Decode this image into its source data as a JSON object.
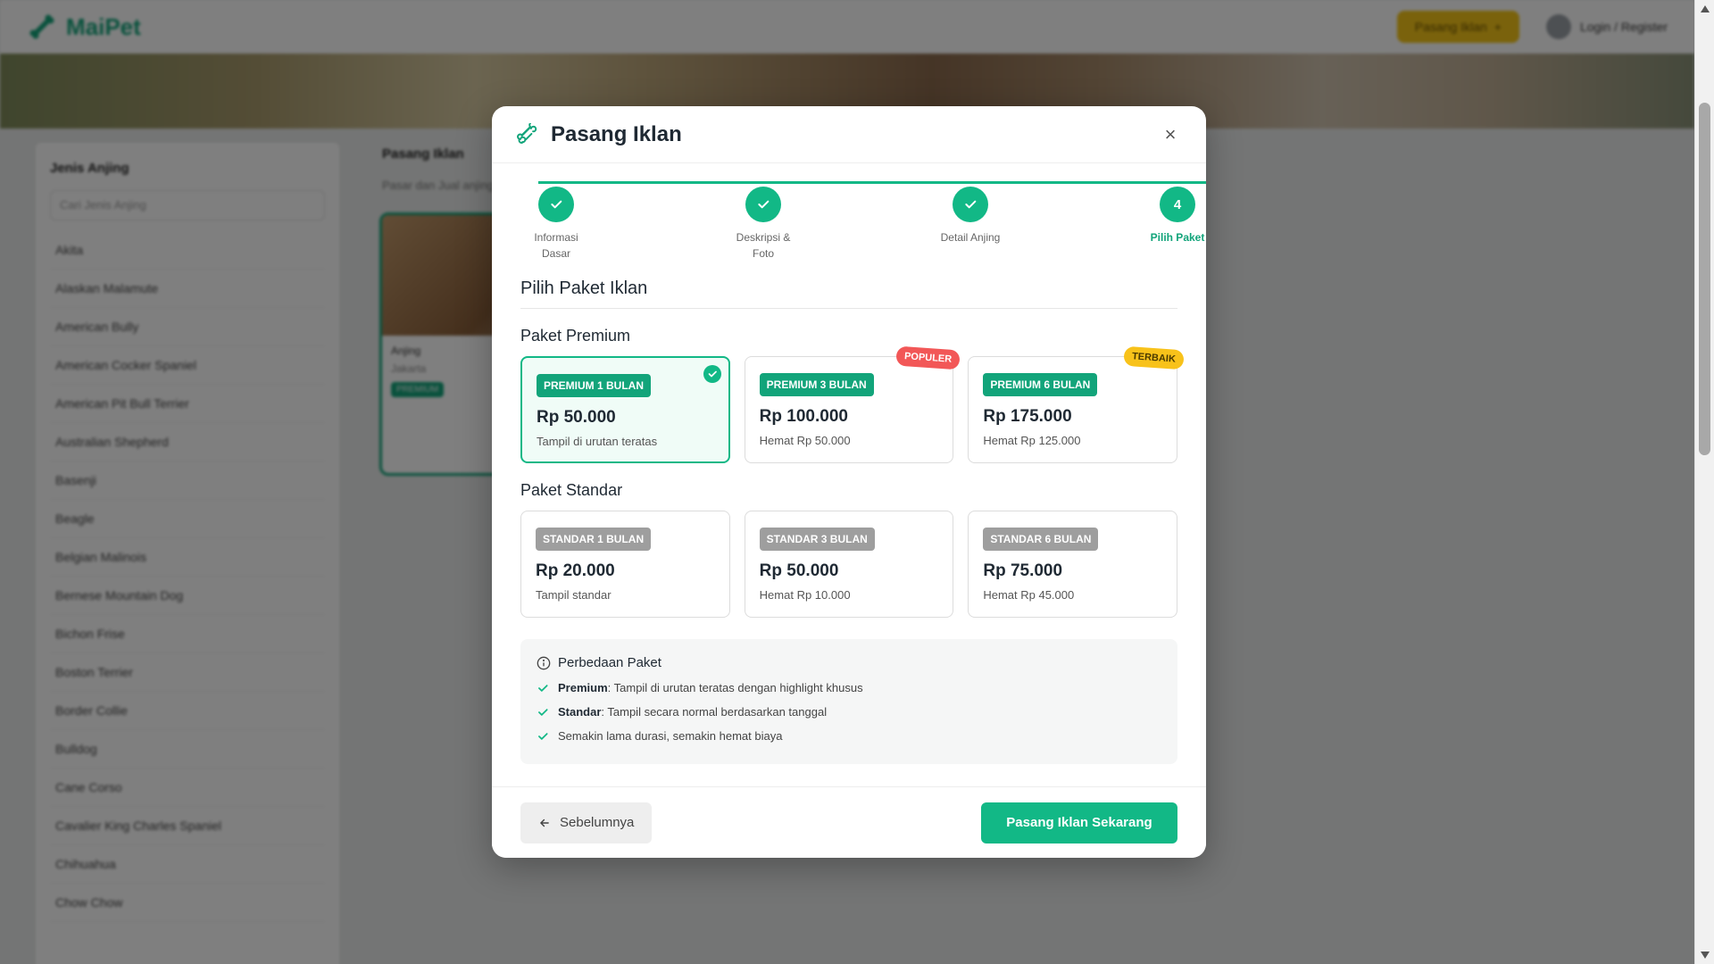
{
  "app": {
    "brand": "MaiPet"
  },
  "topbar": {
    "post_button": "Pasang Iklan",
    "login_label": "Login / Register"
  },
  "sidebar": {
    "title": "Jenis Anjing",
    "search_placeholder": "Cari Jenis Anjing",
    "items": [
      "Akita",
      "Alaskan Malamute",
      "American Bully",
      "American Cocker Spaniel",
      "American Pit Bull Terrier",
      "Australian Shepherd",
      "Basenji",
      "Beagle",
      "Belgian Malinois",
      "Bernese Mountain Dog",
      "Bichon Frise",
      "Boston Terrier",
      "Border Collie",
      "Bulldog",
      "Cane Corso",
      "Cavalier King Charles Spaniel",
      "Chihuahua",
      "Chow Chow"
    ]
  },
  "main": {
    "title": "Pasang Iklan",
    "subtitle": "Pasar dan Jual anjing",
    "card": {
      "name": "Anjing",
      "location": "Jakarta",
      "tag": "PREMIUM"
    }
  },
  "modal": {
    "title": "Pasang Iklan",
    "steps": [
      {
        "label": "Informasi Dasar",
        "status": "done"
      },
      {
        "label": "Deskripsi & Foto",
        "status": "done"
      },
      {
        "label": "Detail Anjing",
        "status": "done"
      },
      {
        "label": "Pilih Paket",
        "number": "4",
        "status": "active"
      }
    ],
    "section_heading": "Pilih Paket Iklan",
    "premium": {
      "title": "Paket Premium",
      "packages": [
        {
          "tag": "PREMIUM 1 BULAN",
          "price": "Rp 50.000",
          "note": "Tampil di urutan teratas",
          "selected": true
        },
        {
          "tag": "PREMIUM 3 BULAN",
          "price": "Rp 100.000",
          "note": "Hemat Rp 50.000",
          "ribbon": "POPULER"
        },
        {
          "tag": "PREMIUM 6 BULAN",
          "price": "Rp 175.000",
          "note": "Hemat Rp 125.000",
          "ribbon": "TERBAIK"
        }
      ]
    },
    "standard": {
      "title": "Paket Standar",
      "packages": [
        {
          "tag": "STANDAR 1 BULAN",
          "price": "Rp 20.000",
          "note": "Tampil standar"
        },
        {
          "tag": "STANDAR 3 BULAN",
          "price": "Rp 50.000",
          "note": "Hemat Rp 10.000"
        },
        {
          "tag": "STANDAR 6 BULAN",
          "price": "Rp 75.000",
          "note": "Hemat Rp 45.000"
        }
      ]
    },
    "info": {
      "title": "Perbedaan Paket",
      "rows": [
        {
          "bold": "Premium",
          "text": ": Tampil di urutan teratas dengan highlight khusus"
        },
        {
          "bold": "Standar",
          "text": ": Tampil secara normal berdasarkan tanggal"
        },
        {
          "bold": "",
          "text": "Semakin lama durasi, semakin hemat biaya"
        }
      ]
    },
    "footer": {
      "prev_label": "Sebelumnya",
      "submit_label": "Pasang Iklan Sekarang"
    }
  },
  "colors": {
    "accent": "#12b886",
    "popular": "#f25757",
    "best": "#f8c21a",
    "standard_tag": "#9e9e9e"
  }
}
